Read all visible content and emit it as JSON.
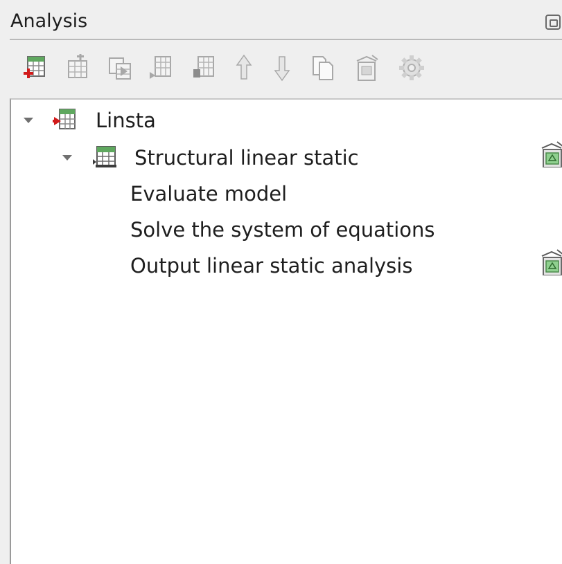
{
  "panel": {
    "title": "Analysis"
  },
  "toolbar": {
    "buttons": [
      {
        "name": "add-analysis-button",
        "icon": "table-add-red-icon"
      },
      {
        "name": "add-analysis-step-button",
        "icon": "table-add-step-icon"
      },
      {
        "name": "insert-step-button",
        "icon": "table-insert-icon"
      },
      {
        "name": "add-child-button",
        "icon": "table-child-icon"
      },
      {
        "name": "add-sibling-button",
        "icon": "table-sibling-icon"
      },
      {
        "name": "move-up-button",
        "icon": "arrow-up-icon"
      },
      {
        "name": "move-down-button",
        "icon": "arrow-down-icon"
      },
      {
        "name": "copy-button",
        "icon": "copy-icon"
      },
      {
        "name": "delete-button",
        "icon": "trash-icon"
      },
      {
        "name": "settings-button",
        "icon": "gear-icon"
      }
    ]
  },
  "tree": {
    "items": [
      {
        "label": "Linsta",
        "level": 0,
        "expanded": true,
        "icon": "analysis-red-table-icon"
      },
      {
        "label": "Structural linear static",
        "level": 1,
        "expanded": true,
        "icon": "analysis-step-table-icon",
        "has_trash": true
      },
      {
        "label": "Evaluate model",
        "level": 2
      },
      {
        "label": "Solve the system of equations",
        "level": 2
      },
      {
        "label": "Output linear static analysis",
        "level": 2,
        "has_trash": true
      }
    ]
  },
  "colors": {
    "background": "#efefef",
    "tree_background": "#ffffff",
    "text": "#1e1e1e",
    "icon_green": "#5fa85f",
    "icon_red": "#d11a1a",
    "disabled_icon": "#b4b4b4"
  }
}
